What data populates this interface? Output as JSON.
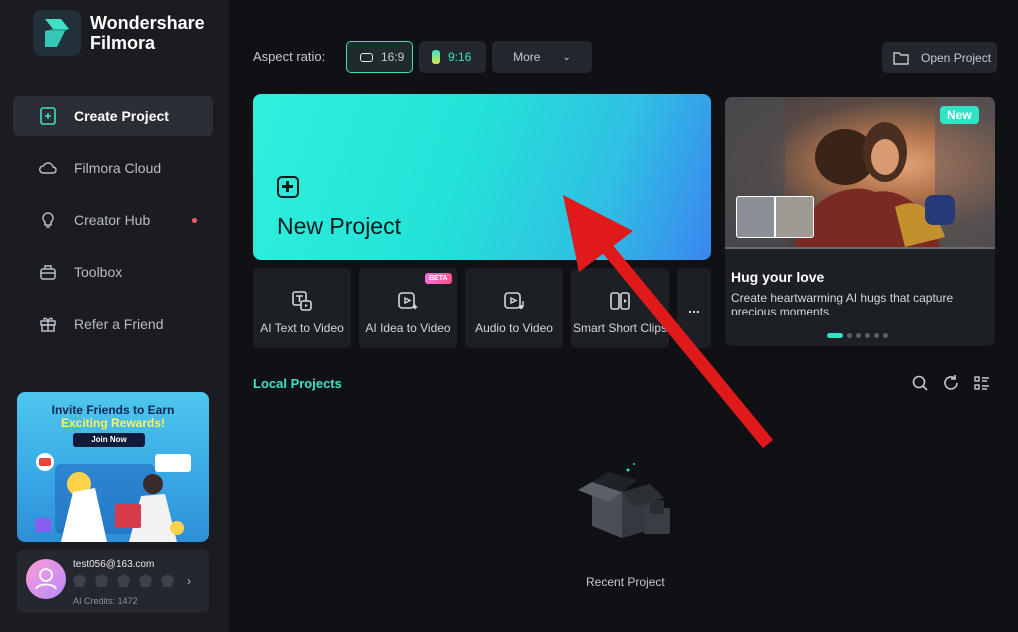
{
  "brand": {
    "line1": "Wondershare",
    "line2": "Filmora"
  },
  "sidebar": {
    "items": [
      {
        "label": "Create Project",
        "icon": "create-project-icon",
        "active": true
      },
      {
        "label": "Filmora Cloud",
        "icon": "cloud-icon"
      },
      {
        "label": "Creator Hub",
        "icon": "lightbulb-icon",
        "badge": "notification-dot"
      },
      {
        "label": "Toolbox",
        "icon": "toolbox-icon"
      },
      {
        "label": "Refer a Friend",
        "icon": "gift-icon"
      }
    ],
    "promo": {
      "line1": "Invite Friends to Earn",
      "line2": "Exciting Rewards!",
      "button": "Join Now"
    },
    "account": {
      "email": "test056@163.com",
      "credits": "AI Credits: 1472"
    }
  },
  "toolbar": {
    "aspect_label": "Aspect ratio:",
    "aspect_options": [
      "16:9",
      "9:16",
      "More"
    ],
    "open_project": "Open Project"
  },
  "new_project": {
    "label": "New Project"
  },
  "tools": [
    {
      "label": "AI Text to Video",
      "icon": "text-to-video-icon"
    },
    {
      "label": "AI Idea to Video",
      "icon": "idea-to-video-icon",
      "badge": "BETA"
    },
    {
      "label": "Audio to Video",
      "icon": "audio-to-video-icon"
    },
    {
      "label": "Smart Short Clips",
      "icon": "smart-clips-icon"
    }
  ],
  "tools_more": "...",
  "featured": {
    "badge": "New",
    "title": "Hug your love",
    "description": "Create heartwarming AI hugs that capture precious moments."
  },
  "local_projects": {
    "title": "Local Projects",
    "empty_label": "Recent Project"
  },
  "colors": {
    "accent": "#3fe0c6",
    "annotation_arrow": "#e0191b"
  }
}
